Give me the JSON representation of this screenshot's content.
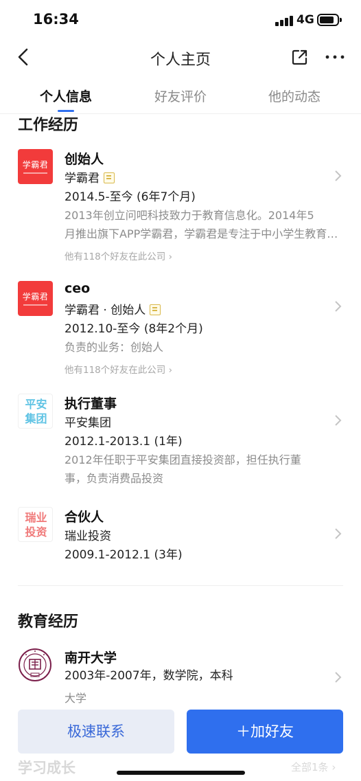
{
  "status_bar": {
    "time": "16:34",
    "network": "4G"
  },
  "nav": {
    "title": "个人主页"
  },
  "tabs": [
    {
      "label": "个人信息",
      "active": true
    },
    {
      "label": "好友评价",
      "active": false
    },
    {
      "label": "他的动态",
      "active": false
    }
  ],
  "work_section": {
    "title": "工作经历"
  },
  "experiences": [
    {
      "title": "创始人",
      "company": "学霸君",
      "logo_text": "学霸君",
      "period": "2014.5-至今 (6年7个月)",
      "desc_line1": "2013年创立问吧科技致力于教育信息化。2014年5",
      "desc_line2": "月推出旗下APP学霸君，学霸君是专注于中小学生教育的智能学习平台",
      "friends": "他有118个好友在此公司",
      "verified": true
    },
    {
      "title": "ceo",
      "company": "学霸君 · 创始人",
      "logo_text": "学霸君",
      "period": "2012.10-至今 (8年2个月)",
      "desc": "负责的业务：创始人",
      "friends": "他有118个好友在此公司",
      "verified": true
    },
    {
      "title": "执行董事",
      "company": "平安集团",
      "logo_line1": "平安",
      "logo_line2": "集团",
      "period": "2012.1-2013.1 (1年)",
      "desc_line1": "2012年任职于平安集团直接投资部，担任执行董",
      "desc_line2": "事，负责消费品投资",
      "logo_color": "#5fc3e4"
    },
    {
      "title": "合伙人",
      "company": "瑞业投资",
      "logo_line1": "瑞业",
      "logo_line2": "投资",
      "period": "2009.1-2012.1 (3年)",
      "logo_color": "#f07a7a"
    }
  ],
  "education_section": {
    "title": "教育经历"
  },
  "education": [
    {
      "school": "南开大学",
      "detail": "2003年-2007年，数学院，本科",
      "type": "大学",
      "logo_color": "#7b1f4b"
    }
  ],
  "bottom": {
    "contact_label": "极速联系",
    "add_friend_label": "＋加好友",
    "next_section_title": "学习成长",
    "next_section_link": "全部1条"
  },
  "colors": {
    "accent": "#2f6fee",
    "brand_red": "#f23b3b"
  }
}
